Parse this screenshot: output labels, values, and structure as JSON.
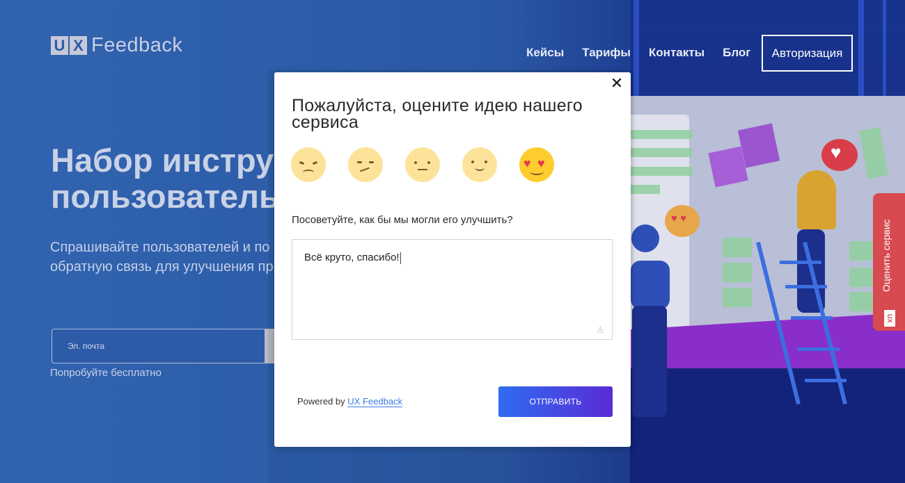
{
  "header": {
    "logo_ux": "UX",
    "logo_text": "Feedback",
    "nav": [
      "Кейсы",
      "Тарифы",
      "Контакты",
      "Блог"
    ],
    "auth_label": "Авторизация"
  },
  "hero": {
    "title_line1": "Набор инстру",
    "title_line2": "пользователь",
    "subtitle_line1": "Спрашивайте пользователей и по",
    "subtitle_line2": "обратную связь для улучшения пр",
    "email_placeholder": "Эл. почта",
    "try_free": "Попробуйте бесплатно"
  },
  "modal": {
    "title": "Пожалуйста, оцените идею нашего сервиса",
    "close_symbol": "✕",
    "ratings": [
      "angry-face-icon",
      "confused-face-icon",
      "neutral-face-icon",
      "slight-smile-face-icon",
      "heart-eyes-face-icon"
    ],
    "selected_rating": 5,
    "question": "Посоветуйте, как бы мы могли его улучшить?",
    "answer_value": "Всё круто, спасибо!",
    "powered_prefix": "Powered by",
    "powered_link": "UX Feedback",
    "send_label": "ОТПРАВИТЬ"
  },
  "side_tab": {
    "label": "Оценить сервис",
    "logo": "UX"
  },
  "colors": {
    "page_bg": "#2c5aa6",
    "accent_blue": "#2f6cf0",
    "accent_purple": "#5a2bd6",
    "side_tab": "#d74a4f"
  }
}
